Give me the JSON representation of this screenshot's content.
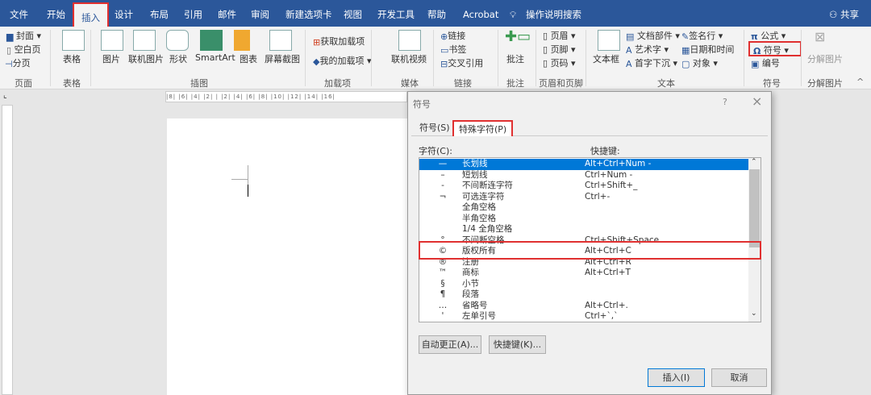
{
  "tabs": [
    "文件",
    "开始",
    "插入",
    "设计",
    "布局",
    "引用",
    "邮件",
    "审阅",
    "新建选项卡",
    "视图",
    "开发工具",
    "帮助",
    "Acrobat"
  ],
  "search": "操作说明搜索",
  "share": "共享",
  "ribbon": {
    "pages": {
      "items": [
        "封面",
        "空白页",
        "分页"
      ],
      "label": "页面"
    },
    "table": {
      "item": "表格",
      "label": "表格"
    },
    "illus": {
      "items": [
        "图片",
        "联机图片",
        "形状",
        "SmartArt",
        "图表",
        "屏幕截图"
      ],
      "label": "插图"
    },
    "addins": {
      "items": [
        "获取加载项",
        "我的加载项"
      ],
      "label": "加载项"
    },
    "media": {
      "item": "联机视频",
      "label": "媒体"
    },
    "links": {
      "items": [
        "链接",
        "书签",
        "交叉引用"
      ],
      "label": "链接"
    },
    "comments": {
      "item": "批注",
      "label": "批注"
    },
    "hf": {
      "items": [
        "页眉",
        "页脚",
        "页码"
      ],
      "label": "页眉和页脚"
    },
    "text": {
      "textbox": "文本框",
      "items": [
        "文档部件",
        "艺术字",
        "首字下沉",
        "签名行",
        "日期和时间",
        "对象"
      ],
      "label": "文本"
    },
    "symbols": {
      "items": [
        "公式",
        "符号",
        "编号"
      ],
      "label": "符号"
    },
    "decomp": {
      "item": "分解图片",
      "label": "分解图片"
    }
  },
  "ruler": "|8| |6| |4| |2| | |2| |4| |6| |8| |10| |12| |14| |16|",
  "dialog": {
    "title": "符号",
    "help": "?",
    "close": "×",
    "tabs": [
      "符号(S)",
      "特殊字符(P)"
    ],
    "col_char": "字符(C):",
    "col_key": "快捷键:",
    "rows": [
      {
        "sym": "—",
        "name": "长划线",
        "key": "Alt+Ctrl+Num -"
      },
      {
        "sym": "–",
        "name": "短划线",
        "key": "Ctrl+Num -"
      },
      {
        "sym": "-",
        "name": "不间断连字符",
        "key": "Ctrl+Shift+_"
      },
      {
        "sym": "¬",
        "name": "可选连字符",
        "key": "Ctrl+-"
      },
      {
        "sym": "",
        "name": "全角空格",
        "key": ""
      },
      {
        "sym": "",
        "name": "半角空格",
        "key": ""
      },
      {
        "sym": "",
        "name": "1/4 全角空格",
        "key": ""
      },
      {
        "sym": "°",
        "name": "不间断空格",
        "key": "Ctrl+Shift+Space"
      },
      {
        "sym": "©",
        "name": "版权所有",
        "key": "Alt+Ctrl+C"
      },
      {
        "sym": "®",
        "name": "注册",
        "key": "Alt+Ctrl+R"
      },
      {
        "sym": "™",
        "name": "商标",
        "key": "Alt+Ctrl+T"
      },
      {
        "sym": "§",
        "name": "小节",
        "key": ""
      },
      {
        "sym": "¶",
        "name": "段落",
        "key": ""
      },
      {
        "sym": "…",
        "name": "省略号",
        "key": "Alt+Ctrl+."
      },
      {
        "sym": "'",
        "name": "左单引号",
        "key": "Ctrl+`,`"
      }
    ],
    "autocorrect": "自动更正(A)...",
    "shortcut": "快捷键(K)...",
    "insert": "插入(I)",
    "cancel": "取消"
  }
}
